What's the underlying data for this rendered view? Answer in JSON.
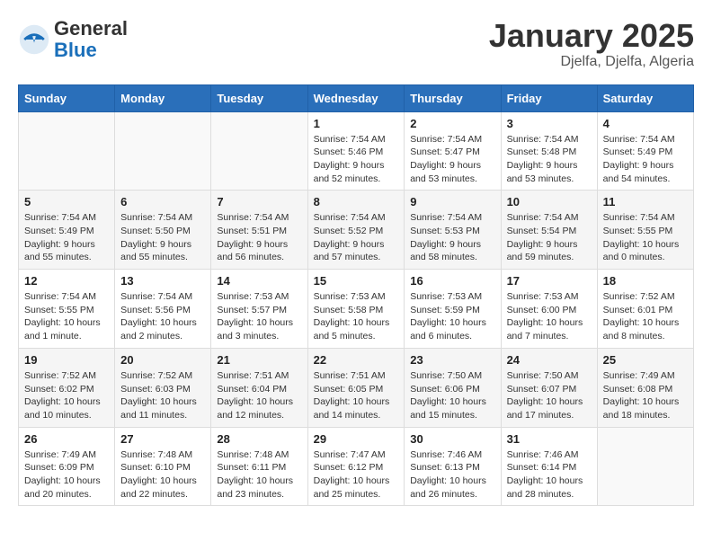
{
  "header": {
    "logo_general": "General",
    "logo_blue": "Blue",
    "month_year": "January 2025",
    "location": "Djelfa, Djelfa, Algeria"
  },
  "days_of_week": [
    "Sunday",
    "Monday",
    "Tuesday",
    "Wednesday",
    "Thursday",
    "Friday",
    "Saturday"
  ],
  "weeks": [
    [
      {
        "day": "",
        "info": ""
      },
      {
        "day": "",
        "info": ""
      },
      {
        "day": "",
        "info": ""
      },
      {
        "day": "1",
        "info": "Sunrise: 7:54 AM\nSunset: 5:46 PM\nDaylight: 9 hours and 52 minutes."
      },
      {
        "day": "2",
        "info": "Sunrise: 7:54 AM\nSunset: 5:47 PM\nDaylight: 9 hours and 53 minutes."
      },
      {
        "day": "3",
        "info": "Sunrise: 7:54 AM\nSunset: 5:48 PM\nDaylight: 9 hours and 53 minutes."
      },
      {
        "day": "4",
        "info": "Sunrise: 7:54 AM\nSunset: 5:49 PM\nDaylight: 9 hours and 54 minutes."
      }
    ],
    [
      {
        "day": "5",
        "info": "Sunrise: 7:54 AM\nSunset: 5:49 PM\nDaylight: 9 hours and 55 minutes."
      },
      {
        "day": "6",
        "info": "Sunrise: 7:54 AM\nSunset: 5:50 PM\nDaylight: 9 hours and 55 minutes."
      },
      {
        "day": "7",
        "info": "Sunrise: 7:54 AM\nSunset: 5:51 PM\nDaylight: 9 hours and 56 minutes."
      },
      {
        "day": "8",
        "info": "Sunrise: 7:54 AM\nSunset: 5:52 PM\nDaylight: 9 hours and 57 minutes."
      },
      {
        "day": "9",
        "info": "Sunrise: 7:54 AM\nSunset: 5:53 PM\nDaylight: 9 hours and 58 minutes."
      },
      {
        "day": "10",
        "info": "Sunrise: 7:54 AM\nSunset: 5:54 PM\nDaylight: 9 hours and 59 minutes."
      },
      {
        "day": "11",
        "info": "Sunrise: 7:54 AM\nSunset: 5:55 PM\nDaylight: 10 hours and 0 minutes."
      }
    ],
    [
      {
        "day": "12",
        "info": "Sunrise: 7:54 AM\nSunset: 5:55 PM\nDaylight: 10 hours and 1 minute."
      },
      {
        "day": "13",
        "info": "Sunrise: 7:54 AM\nSunset: 5:56 PM\nDaylight: 10 hours and 2 minutes."
      },
      {
        "day": "14",
        "info": "Sunrise: 7:53 AM\nSunset: 5:57 PM\nDaylight: 10 hours and 3 minutes."
      },
      {
        "day": "15",
        "info": "Sunrise: 7:53 AM\nSunset: 5:58 PM\nDaylight: 10 hours and 5 minutes."
      },
      {
        "day": "16",
        "info": "Sunrise: 7:53 AM\nSunset: 5:59 PM\nDaylight: 10 hours and 6 minutes."
      },
      {
        "day": "17",
        "info": "Sunrise: 7:53 AM\nSunset: 6:00 PM\nDaylight: 10 hours and 7 minutes."
      },
      {
        "day": "18",
        "info": "Sunrise: 7:52 AM\nSunset: 6:01 PM\nDaylight: 10 hours and 8 minutes."
      }
    ],
    [
      {
        "day": "19",
        "info": "Sunrise: 7:52 AM\nSunset: 6:02 PM\nDaylight: 10 hours and 10 minutes."
      },
      {
        "day": "20",
        "info": "Sunrise: 7:52 AM\nSunset: 6:03 PM\nDaylight: 10 hours and 11 minutes."
      },
      {
        "day": "21",
        "info": "Sunrise: 7:51 AM\nSunset: 6:04 PM\nDaylight: 10 hours and 12 minutes."
      },
      {
        "day": "22",
        "info": "Sunrise: 7:51 AM\nSunset: 6:05 PM\nDaylight: 10 hours and 14 minutes."
      },
      {
        "day": "23",
        "info": "Sunrise: 7:50 AM\nSunset: 6:06 PM\nDaylight: 10 hours and 15 minutes."
      },
      {
        "day": "24",
        "info": "Sunrise: 7:50 AM\nSunset: 6:07 PM\nDaylight: 10 hours and 17 minutes."
      },
      {
        "day": "25",
        "info": "Sunrise: 7:49 AM\nSunset: 6:08 PM\nDaylight: 10 hours and 18 minutes."
      }
    ],
    [
      {
        "day": "26",
        "info": "Sunrise: 7:49 AM\nSunset: 6:09 PM\nDaylight: 10 hours and 20 minutes."
      },
      {
        "day": "27",
        "info": "Sunrise: 7:48 AM\nSunset: 6:10 PM\nDaylight: 10 hours and 22 minutes."
      },
      {
        "day": "28",
        "info": "Sunrise: 7:48 AM\nSunset: 6:11 PM\nDaylight: 10 hours and 23 minutes."
      },
      {
        "day": "29",
        "info": "Sunrise: 7:47 AM\nSunset: 6:12 PM\nDaylight: 10 hours and 25 minutes."
      },
      {
        "day": "30",
        "info": "Sunrise: 7:46 AM\nSunset: 6:13 PM\nDaylight: 10 hours and 26 minutes."
      },
      {
        "day": "31",
        "info": "Sunrise: 7:46 AM\nSunset: 6:14 PM\nDaylight: 10 hours and 28 minutes."
      },
      {
        "day": "",
        "info": ""
      }
    ]
  ]
}
